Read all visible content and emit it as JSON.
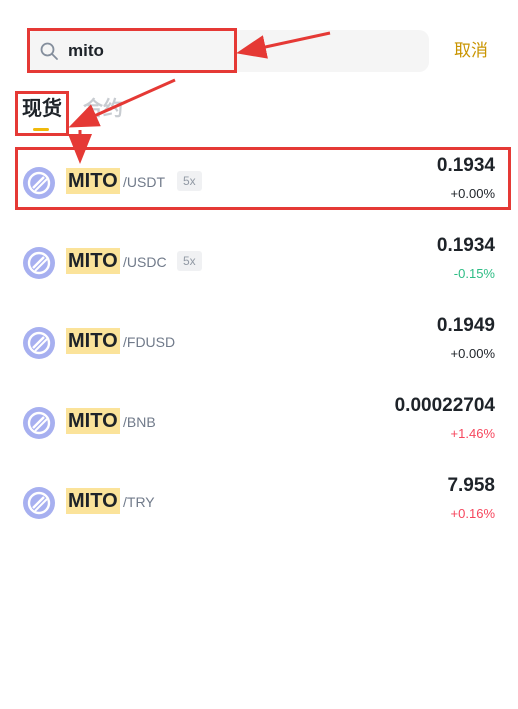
{
  "search": {
    "value": "mito",
    "cancel_label": "取消"
  },
  "tabs": [
    {
      "label": "现货",
      "active": true
    },
    {
      "label": "合约",
      "active": false
    }
  ],
  "results": [
    {
      "base": "MITO",
      "quote": "/USDT",
      "leverage": "5x",
      "price": "0.1934",
      "change": "+0.00%",
      "change_color": "#1e2329"
    },
    {
      "base": "MITO",
      "quote": "/USDC",
      "leverage": "5x",
      "price": "0.1934",
      "change": "-0.15%",
      "change_color": "#2ebd85"
    },
    {
      "base": "MITO",
      "quote": "/FDUSD",
      "leverage": "",
      "price": "0.1949",
      "change": "+0.00%",
      "change_color": "#1e2329"
    },
    {
      "base": "MITO",
      "quote": "/BNB",
      "leverage": "",
      "price": "0.00022704",
      "change": "+1.46%",
      "change_color": "#f6465d"
    },
    {
      "base": "MITO",
      "quote": "/TRY",
      "leverage": "",
      "price": "7.958",
      "change": "+0.16%",
      "change_color": "#f6465d"
    }
  ],
  "colors": {
    "accent": "#f0b90b",
    "highlight": "#fbe39a",
    "cancel": "#c99400",
    "annotation": "#e53935"
  }
}
